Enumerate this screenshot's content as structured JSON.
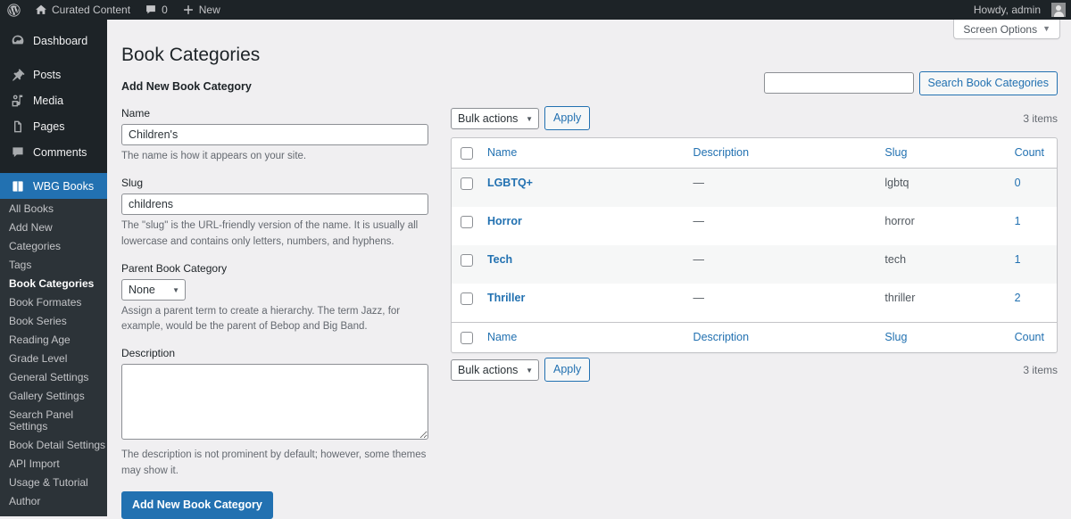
{
  "adminbar": {
    "wp_logo_icon": "wordpress-logo-icon",
    "site_icon": "home-icon",
    "site_name": "Curated Content",
    "comments_icon": "comment-bubble-icon",
    "comments_count": "0",
    "new_icon": "plus-icon",
    "new_label": "New",
    "howdy": "Howdy, admin",
    "avatar_icon": "user-avatar-icon"
  },
  "sidebar": {
    "top_items": [
      {
        "label": "Dashboard",
        "icon": "dashboard-icon",
        "current": false
      },
      {
        "label": "Posts",
        "icon": "pin-icon",
        "current": false
      },
      {
        "label": "Media",
        "icon": "media-icon",
        "current": false
      },
      {
        "label": "Pages",
        "icon": "pages-icon",
        "current": false
      },
      {
        "label": "Comments",
        "icon": "comment-bubble-icon",
        "current": false
      },
      {
        "label": "WBG Books",
        "icon": "book-icon",
        "current": true
      }
    ],
    "submenu": [
      {
        "label": "All Books",
        "current": false
      },
      {
        "label": "Add New",
        "current": false
      },
      {
        "label": "Categories",
        "current": false
      },
      {
        "label": "Tags",
        "current": false
      },
      {
        "label": "Book Categories",
        "current": true
      },
      {
        "label": "Book Formates",
        "current": false
      },
      {
        "label": "Book Series",
        "current": false
      },
      {
        "label": "Reading Age",
        "current": false
      },
      {
        "label": "Grade Level",
        "current": false
      },
      {
        "label": "General Settings",
        "current": false
      },
      {
        "label": "Gallery Settings",
        "current": false
      },
      {
        "label": "Search Panel Settings",
        "current": false
      },
      {
        "label": "Book Detail Settings",
        "current": false
      },
      {
        "label": "API Import",
        "current": false
      },
      {
        "label": "Usage & Tutorial",
        "current": false
      },
      {
        "label": "Author",
        "current": false
      }
    ]
  },
  "screen_meta": {
    "screen_options_label": "Screen Options",
    "caret_icon": "caret-down-icon"
  },
  "page": {
    "title": "Book Categories"
  },
  "form": {
    "heading": "Add New Book Category",
    "name_label": "Name",
    "name_value": "Children's",
    "name_help": "The name is how it appears on your site.",
    "slug_label": "Slug",
    "slug_value": "childrens",
    "slug_help": "The \"slug\" is the URL-friendly version of the name. It is usually all lowercase and contains only letters, numbers, and hyphens.",
    "parent_label": "Parent Book Category",
    "parent_value": "None",
    "parent_options": [
      "None"
    ],
    "parent_help": "Assign a parent term to create a hierarchy. The term Jazz, for example, would be the parent of Bebop and Big Band.",
    "description_label": "Description",
    "description_value": "",
    "description_help": "The description is not prominent by default; however, some themes may show it.",
    "submit_label": "Add New Book Category"
  },
  "search": {
    "value": "",
    "button_label": "Search Book Categories"
  },
  "tablenav_top": {
    "bulk_value": "Bulk actions",
    "bulk_options": [
      "Bulk actions"
    ],
    "apply_label": "Apply",
    "displaying_num": "3 items"
  },
  "tablenav_bottom": {
    "bulk_value": "Bulk actions",
    "bulk_options": [
      "Bulk actions"
    ],
    "apply_label": "Apply",
    "displaying_num": "3 items"
  },
  "table": {
    "columns": {
      "name": "Name",
      "description": "Description",
      "slug": "Slug",
      "count": "Count"
    },
    "rows": [
      {
        "name": "LGBTQ+",
        "description": "—",
        "slug": "lgbtq",
        "count": "0"
      },
      {
        "name": "Horror",
        "description": "—",
        "slug": "horror",
        "count": "1"
      },
      {
        "name": "Tech",
        "description": "—",
        "slug": "tech",
        "count": "1"
      },
      {
        "name": "Thriller",
        "description": "—",
        "slug": "thriller",
        "count": "2"
      }
    ]
  },
  "colors": {
    "admin_bar": "#1d2327",
    "sidebar": "#1d2327",
    "submenu": "#2c3338",
    "accent": "#2271b1",
    "page_bg": "#f0eff1",
    "row_alt": "#f6f7f7"
  }
}
